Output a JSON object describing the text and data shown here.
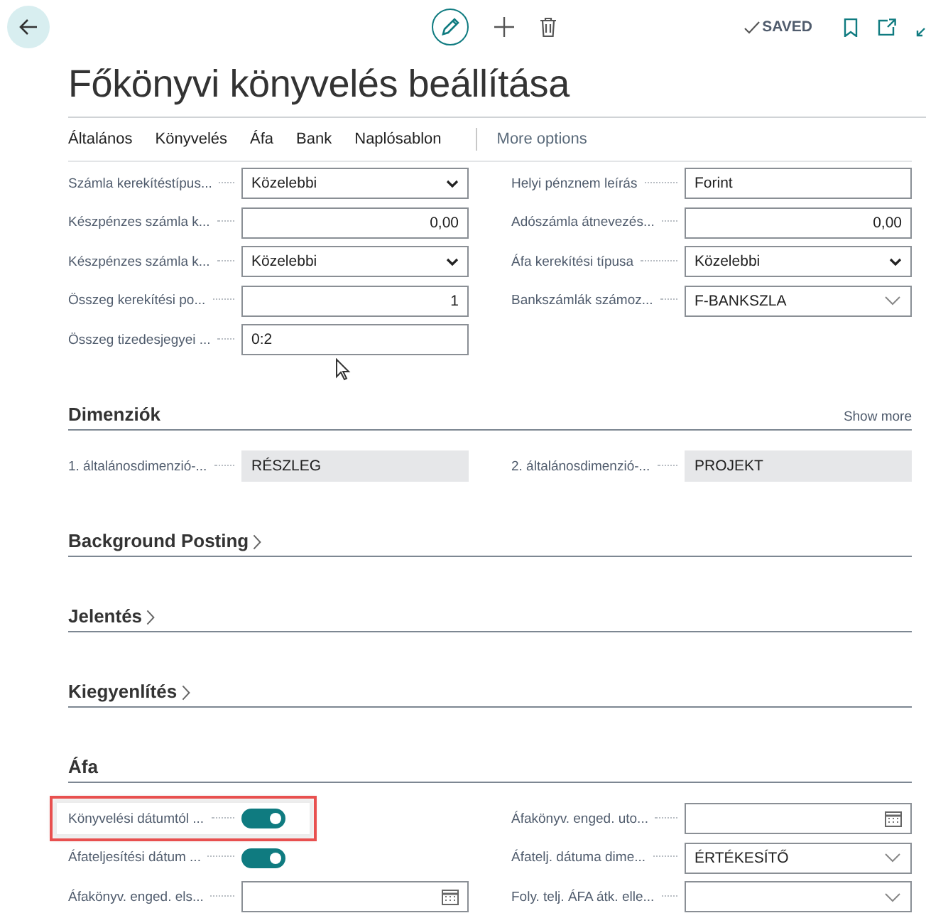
{
  "toolbar": {
    "status": "SAVED"
  },
  "title": "Főkönyvi könyvelés beállítása",
  "tabs": [
    {
      "label": "Általános"
    },
    {
      "label": "Könyvelés"
    },
    {
      "label": "Áfa"
    },
    {
      "label": "Bank"
    },
    {
      "label": "Naplósablon"
    },
    {
      "label": "More options",
      "kind": "more"
    }
  ],
  "sections": [
    {
      "columns": [
        [
          {
            "label": "Számla kerekítéstípus...",
            "kind": "select",
            "value": "Közelebbi"
          },
          {
            "label": "Készpénzes számla k...",
            "kind": "number",
            "value": "0,00"
          },
          {
            "label": "Készpénzes számla k...",
            "kind": "select",
            "value": "Közelebbi"
          },
          {
            "label": "Összeg kerekítési po...",
            "kind": "number",
            "value": "1"
          },
          {
            "label": "Összeg tizedesjegyei ...",
            "kind": "text",
            "value": "0:2"
          }
        ],
        [
          {
            "label": "Helyi pénznem leírás",
            "kind": "text",
            "value": "Forint"
          },
          {
            "label": "Adószámla átnevezés...",
            "kind": "number",
            "value": "0,00"
          },
          {
            "label": "Áfa kerekítési típusa",
            "kind": "select",
            "value": "Közelebbi"
          },
          {
            "label": "Bankszámlák számoz...",
            "kind": "lookup",
            "value": "F-BANKSZLA"
          }
        ]
      ]
    },
    {
      "heading": "Dimenziók",
      "expanded": true,
      "action": "Show more",
      "columns": [
        [
          {
            "label": "1. általánosdimenzió-...",
            "kind": "readonly",
            "value": "RÉSZLEG"
          }
        ],
        [
          {
            "label": "2. általánosdimenzió-...",
            "kind": "readonly",
            "value": "PROJEKT"
          }
        ]
      ]
    },
    {
      "heading": "Background Posting",
      "expanded": false
    },
    {
      "heading": "Jelentés",
      "expanded": false
    },
    {
      "heading": "Kiegyenlítés",
      "expanded": false
    },
    {
      "heading": "Áfa",
      "expanded": true,
      "columns": [
        [
          {
            "label": "Könyvelési dátumtól ...",
            "kind": "toggle",
            "on": true,
            "highlighted": true
          },
          {
            "label": "Áfateljesítési dátum ...",
            "kind": "toggle",
            "on": true
          },
          {
            "label": "Áfakönyv. enged. els...",
            "kind": "date"
          }
        ],
        [
          {
            "label": "Áfakönyv. enged. uto...",
            "kind": "date"
          },
          {
            "label": "Áfatelj. dátuma dime...",
            "kind": "lookup",
            "value": "ÉRTÉKESÍTŐ"
          },
          {
            "label": "Foly. telj. ÁFA átk. elle...",
            "kind": "lookup"
          }
        ]
      ]
    }
  ]
}
